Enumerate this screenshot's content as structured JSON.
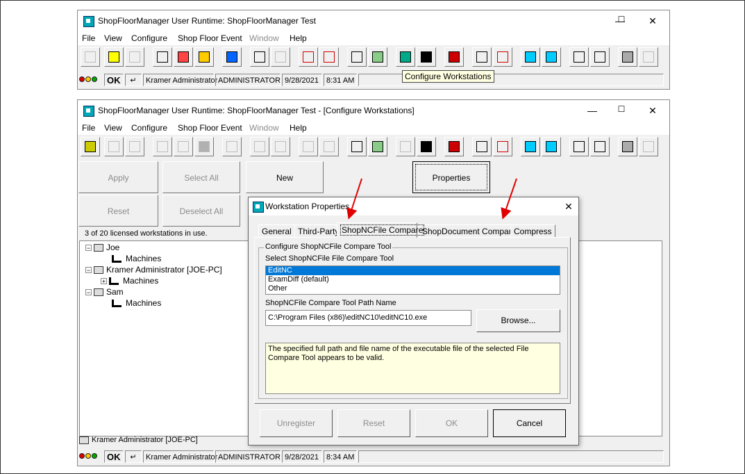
{
  "window1": {
    "title": "ShopFloorManager User Runtime: ShopFloorManager Test",
    "controls": {
      "minimize": "—",
      "maximize": "☐",
      "close": "✕"
    },
    "menu": [
      "File",
      "View",
      "Configure",
      "Shop Floor Event",
      "Window",
      "Help"
    ],
    "status": {
      "ok": "OK",
      "arrow": "↵",
      "user": "Kramer Administrator",
      "role": "ADMINISTRATOR",
      "date": "9/28/2021",
      "time": "8:31 AM"
    },
    "tooltip": "Configure Workstations"
  },
  "window2": {
    "title": "ShopFloorManager User Runtime: ShopFloorManager Test - [Configure Workstations]",
    "controls": {
      "minimize": "—",
      "maximize": "☐",
      "close": "✕"
    },
    "menu": [
      "File",
      "View",
      "Configure",
      "Shop Floor Event",
      "Window",
      "Help"
    ],
    "commands": {
      "apply": "Apply",
      "select_all": "Select All",
      "new": "New",
      "properties": "Properties",
      "reset": "Reset",
      "deselect_all": "Deselect All"
    },
    "license": "3 of 20 licensed workstations in use.",
    "tree": [
      {
        "label": "Joe",
        "child": "Machines"
      },
      {
        "label": "Kramer Administrator [JOE-PC]",
        "child": "Machines"
      },
      {
        "label": "Sam",
        "child": "Machines"
      }
    ],
    "selected_workstation": "Kramer Administrator [JOE-PC]",
    "status": {
      "ok": "OK",
      "arrow": "↵",
      "user": "Kramer Administrator",
      "role": "ADMINISTRATOR",
      "date": "9/28/2021",
      "time": "8:34 AM"
    }
  },
  "dialog": {
    "title": "Workstation Properties",
    "close": "✕",
    "tabs": [
      "General",
      "Third-Party",
      "ShopNCFile Compare",
      "ShopDocument Compare",
      "Compress"
    ],
    "active_tab": "ShopNCFile Compare",
    "group_label": "Configure ShopNCFile Compare Tool",
    "select_label": "Select ShopNCFile File Compare Tool",
    "options": [
      "EditNC",
      "ExamDiff (default)",
      "Other"
    ],
    "selected_option": "EditNC",
    "path_label": "ShopNCFile Compare Tool Path Name",
    "path_value": "C:\\Program Files (x86)\\editNC10\\editNC10.exe",
    "browse": "Browse...",
    "message": "The specified full path and file name of the executable file of the selected File Compare Tool appears to be valid.",
    "buttons": {
      "unregister": "Unregister",
      "reset": "Reset",
      "ok": "OK",
      "cancel": "Cancel"
    }
  },
  "colors": {
    "selection": "#0078d7",
    "info_bg": "#ffffe1",
    "arrow": "#e00000"
  }
}
